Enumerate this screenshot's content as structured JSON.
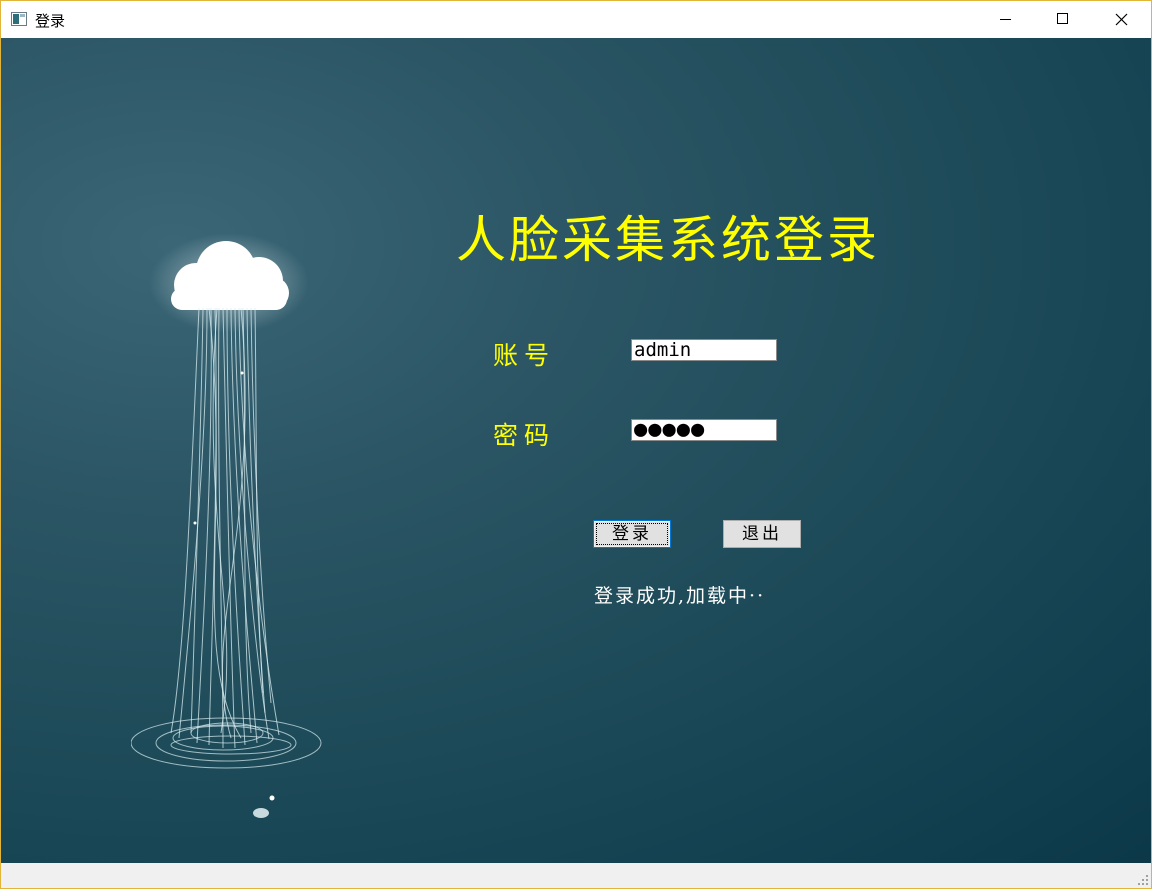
{
  "window": {
    "title": "登录",
    "controls": [
      "minimize",
      "maximize",
      "close"
    ]
  },
  "login": {
    "heading": "人脸采集系统登录",
    "account_label": "账号",
    "account_value": "admin",
    "password_label": "密码",
    "password_value": "●●●●●",
    "login_button": "登录",
    "exit_button": "退出",
    "status": "登录成功,加载中··"
  },
  "colors": {
    "accent_text": "#ffff00",
    "background": "#1d4a58",
    "window_border": "#e3b43a"
  },
  "icons": {
    "app": "window-app-icon",
    "minimize": "minimize-icon",
    "maximize": "maximize-icon",
    "close": "close-icon",
    "resize": "resize-grip-icon",
    "illustration": "cloud-rain-illustration"
  }
}
